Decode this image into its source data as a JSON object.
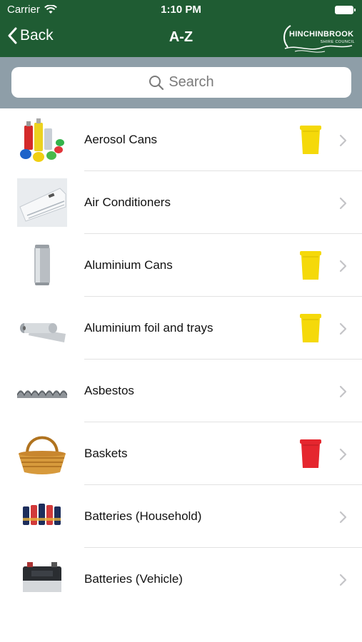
{
  "status": {
    "carrier": "Carrier",
    "time": "1:10 PM"
  },
  "nav": {
    "back_label": "Back",
    "title": "A-Z",
    "logo_text": "HINCHINBROOK",
    "logo_subtext": "SHIRE COUNCIL"
  },
  "search": {
    "placeholder": "Search"
  },
  "colors": {
    "header": "#1f5c33",
    "search_bg": "#8e9ea8",
    "yellow_bin": "#f5d90a",
    "red_bin": "#e5262e"
  },
  "items": [
    {
      "label": "Aerosol Cans",
      "thumb": "aerosol-cans-image",
      "bin": "yellow"
    },
    {
      "label": "Air Conditioners",
      "thumb": "air-conditioner-image",
      "bin": null
    },
    {
      "label": "Aluminium Cans",
      "thumb": "aluminium-can-image",
      "bin": "yellow"
    },
    {
      "label": "Aluminium foil and trays",
      "thumb": "aluminium-foil-image",
      "bin": "yellow"
    },
    {
      "label": "Asbestos",
      "thumb": "asbestos-sheet-image",
      "bin": null
    },
    {
      "label": "Baskets",
      "thumb": "basket-image",
      "bin": "red"
    },
    {
      "label": "Batteries (Household)",
      "thumb": "household-batteries-image",
      "bin": null
    },
    {
      "label": "Batteries (Vehicle)",
      "thumb": "car-battery-image",
      "bin": null
    }
  ]
}
